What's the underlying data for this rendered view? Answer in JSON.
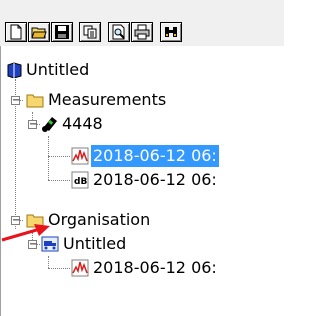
{
  "toolbar": {
    "buttons": [
      {
        "name": "new-icon"
      },
      {
        "name": "open-icon"
      },
      {
        "name": "save-icon"
      },
      {
        "name": "copy-icon"
      },
      {
        "name": "print-preview-icon"
      },
      {
        "name": "print-icon"
      },
      {
        "name": "binoculars-icon"
      }
    ]
  },
  "tree": {
    "root": {
      "label": "Untitled"
    },
    "measurements": {
      "label": "Measurements"
    },
    "device": {
      "label": "4448"
    },
    "measure_1": {
      "label": "2018-06-12 06:",
      "selected": true
    },
    "measure_2": {
      "label": "2018-06-12 06:"
    },
    "organisation": {
      "label": "Organisation"
    },
    "org_untitled": {
      "label": "Untitled"
    },
    "org_measure": {
      "label": "2018-06-12 06:"
    }
  },
  "colors": {
    "selection": "#3399ff",
    "annotation_arrow": "#e8141c",
    "folder": "#f5d76e",
    "measure_red": "#d81e1e"
  }
}
